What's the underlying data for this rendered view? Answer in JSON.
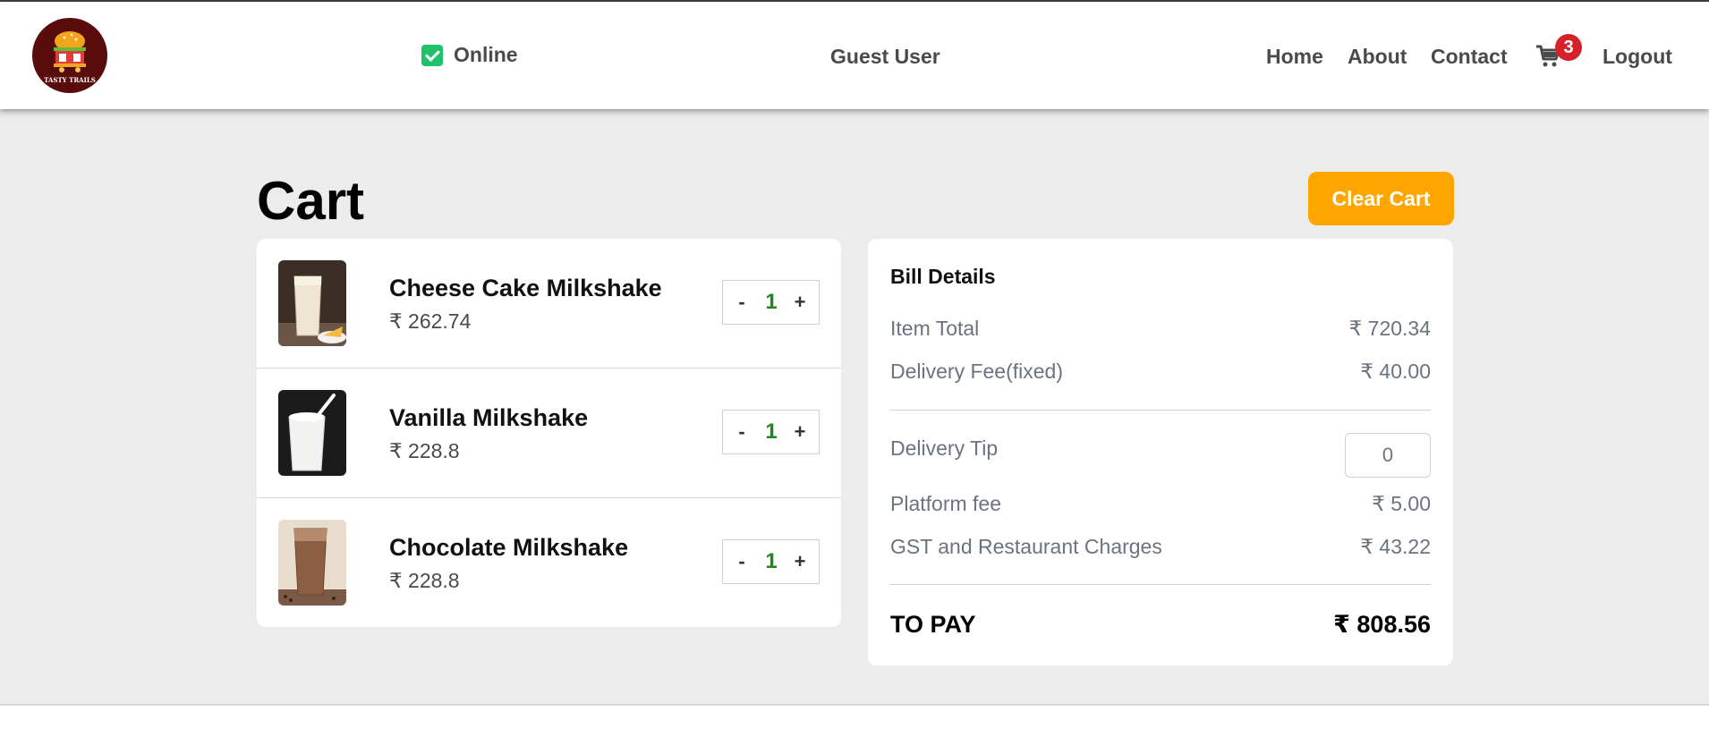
{
  "header": {
    "logo_text": "TASTY TRAILS",
    "status_label": "Online",
    "user_label": "Guest User",
    "nav": [
      "Home",
      "About",
      "Contact"
    ],
    "cart_count": "3",
    "logout_label": "Logout"
  },
  "page": {
    "title": "Cart",
    "clear_label": "Clear Cart"
  },
  "cart_items": [
    {
      "name": "Cheese Cake Milkshake",
      "price": "₹ 262.74",
      "qty": "1"
    },
    {
      "name": "Vanilla Milkshake",
      "price": "₹ 228.8",
      "qty": "1"
    },
    {
      "name": "Chocolate Milkshake",
      "price": "₹ 228.8",
      "qty": "1"
    }
  ],
  "qty_controls": {
    "minus": "-",
    "plus": "+"
  },
  "bill": {
    "title": "Bill Details",
    "item_total_label": "Item Total",
    "item_total": "₹ 720.34",
    "delivery_label": "Delivery Fee(fixed)",
    "delivery": "₹ 40.00",
    "tip_label": "Delivery Tip",
    "tip_placeholder": "0",
    "platform_label": "Platform fee",
    "platform": "₹ 5.00",
    "gst_label": "GST and Restaurant Charges",
    "gst": "₹ 43.22",
    "topay_label": "TO PAY",
    "topay": "₹ 808.56"
  },
  "colors": {
    "accent": "#ffa500",
    "badge": "#d6202a",
    "online": "#1fc16b",
    "qty": "#1a8a1a",
    "background": "#ececec"
  }
}
